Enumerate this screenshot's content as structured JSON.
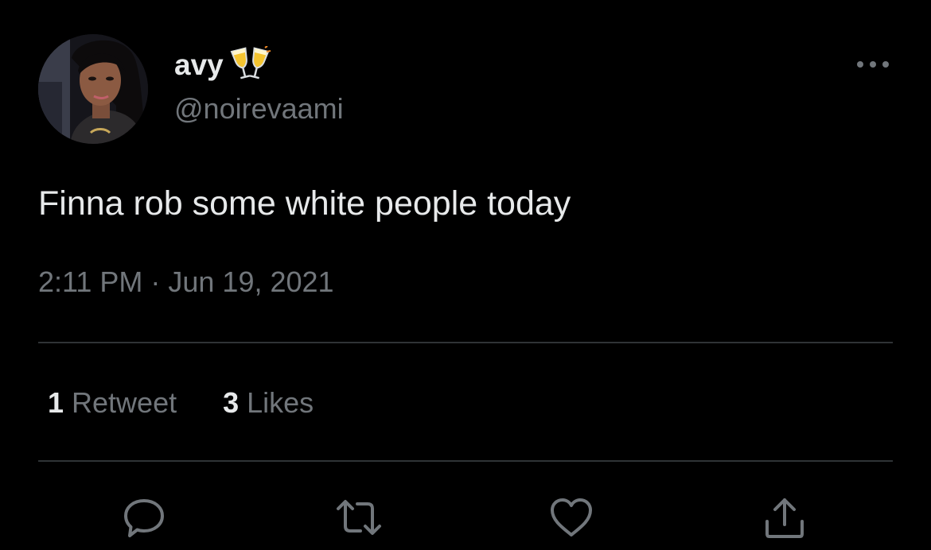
{
  "author": {
    "display_name": "avy",
    "name_emoji": "clinking-glasses-emoji",
    "handle": "@noirevaami",
    "avatar": "profile-photo"
  },
  "tweet": {
    "text": "Finna rob some white people today",
    "timestamp": "2:11 PM · Jun 19, 2021"
  },
  "stats": {
    "retweets_count": "1",
    "retweets_label": "Retweet",
    "likes_count": "3",
    "likes_label": "Likes"
  },
  "actions": {
    "reply_icon": "speech-bubble-icon",
    "retweet_icon": "retweet-arrows-icon",
    "like_icon": "heart-icon",
    "share_icon": "share-upload-icon",
    "more_icon": "more-dots-icon"
  },
  "colors": {
    "background": "#000000",
    "primary_text": "#e7e9ea",
    "secondary_text": "#71767b",
    "divider": "#2f3336"
  }
}
